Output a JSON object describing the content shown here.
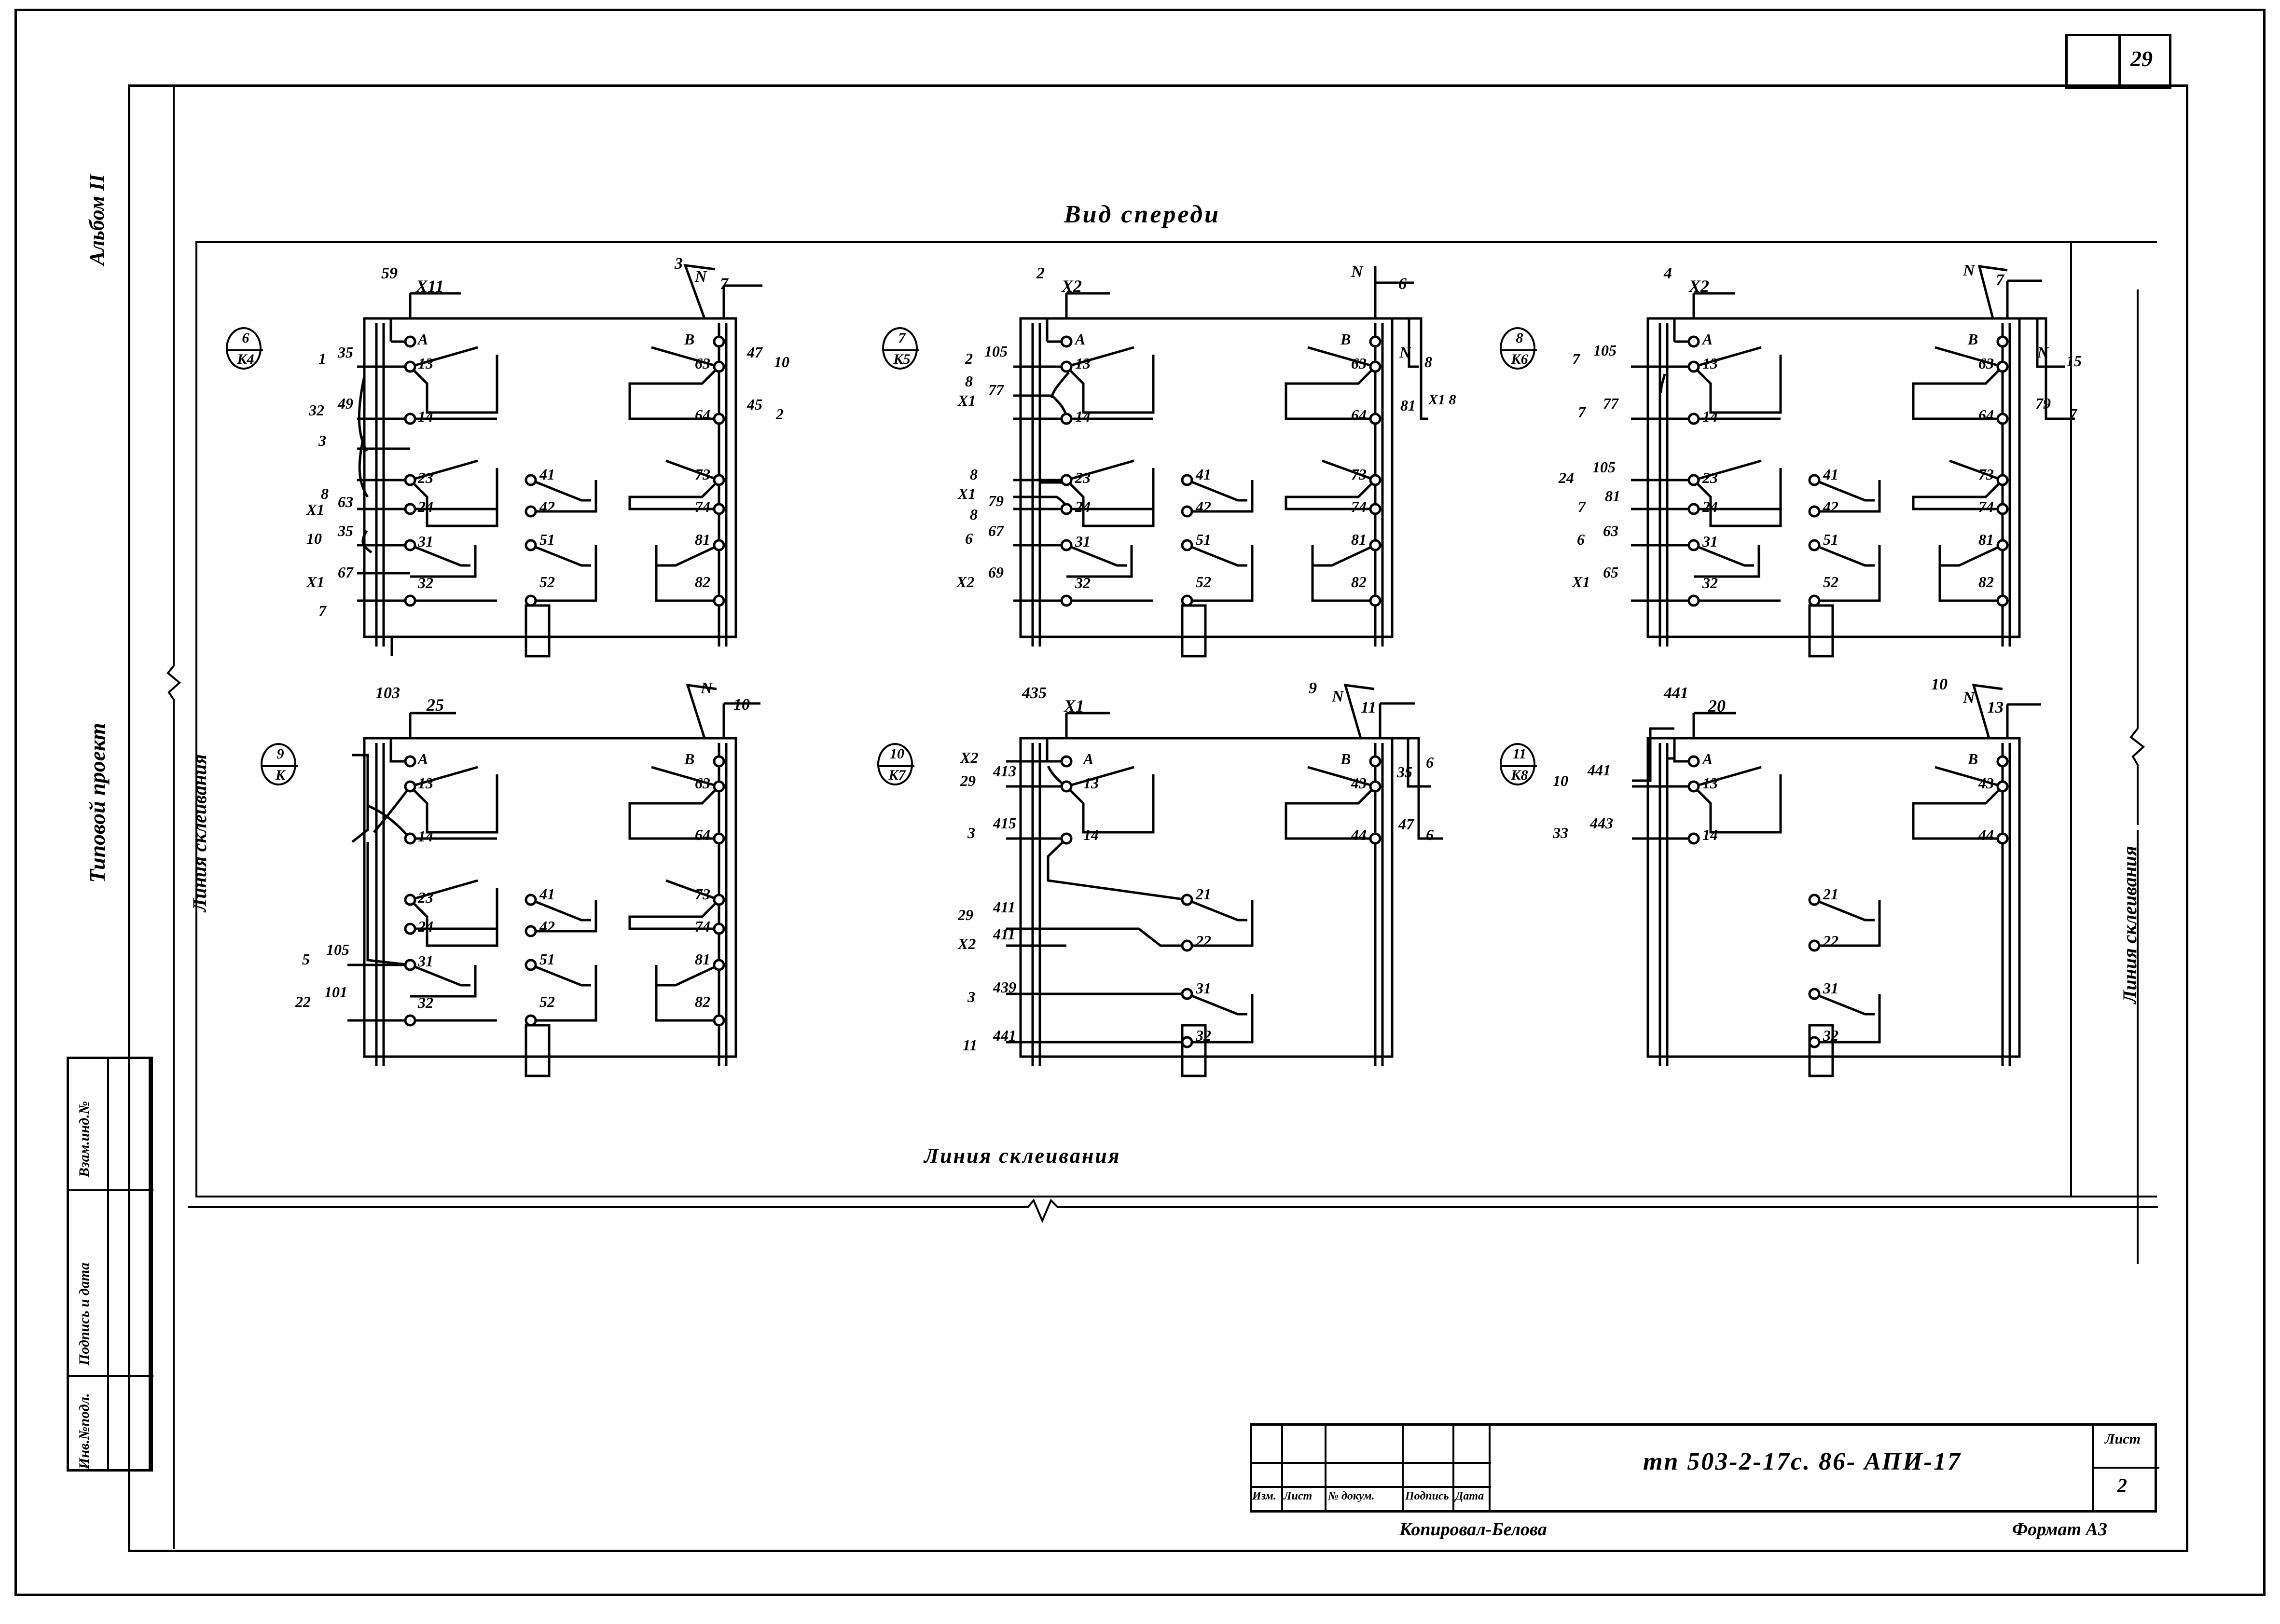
{
  "sheet": {
    "page_number": "29",
    "view_title": "Вид спереди",
    "glue_line_bottom": "Линия склеивания",
    "glue_line_left": "Линия склеивания",
    "glue_line_right": "Линия склеивания",
    "album": "Альбом II",
    "project": "Типовой проект",
    "stamp_rows": [
      "Взам.инд.№",
      "Подпись и дата",
      "Инв.№подл."
    ]
  },
  "title_block": {
    "columns": [
      "Изм.",
      "Лист",
      "№ докум.",
      "Подпись",
      "Дата"
    ],
    "drawing_code": "тп  503-2-17с. 86-  АПИ-17",
    "sheet_label": "Лист",
    "sheet_value": "2",
    "copied_by": "Копировал-Белова",
    "format": "Формат А3"
  },
  "blocks": [
    {
      "id": "b6",
      "marker_top": "6",
      "marker_bottom": "К4",
      "top_left": {
        "wire": "59",
        "term": "X11"
      },
      "top_right": {
        "wire": "3",
        "phase": "N",
        "term": "7"
      },
      "left_terminals": [
        {
          "pin": "A",
          "wire": "",
          "node": ""
        },
        {
          "pin": "13",
          "wire": "35",
          "node": "1"
        },
        {
          "pin": "14",
          "wire": "49",
          "node": "32"
        },
        {
          "pin": "",
          "wire": "",
          "node": "3"
        },
        {
          "pin": "23",
          "wire": "",
          "node": ""
        },
        {
          "pin": "",
          "wire": "",
          "node": "8"
        },
        {
          "pin": "24",
          "wire": "63",
          "node": "X1"
        },
        {
          "pin": "31",
          "wire": "35",
          "node": "10"
        },
        {
          "pin": "32",
          "wire": "67",
          "node": "X1"
        },
        {
          "pin": "",
          "wire": "",
          "node": "7"
        }
      ],
      "mid_terminals": [
        "41",
        "42",
        "51",
        "52"
      ],
      "right_terminals": [
        {
          "pin": "B",
          "wire": "",
          "node": ""
        },
        {
          "pin": "63",
          "wire": "47",
          "node": "10"
        },
        {
          "pin": "64",
          "wire": "45",
          "node": "2"
        },
        {
          "pin": "73",
          "wire": "",
          "node": ""
        },
        {
          "pin": "74",
          "wire": "",
          "node": ""
        },
        {
          "pin": "81",
          "wire": "",
          "node": ""
        },
        {
          "pin": "82",
          "wire": "",
          "node": ""
        }
      ]
    },
    {
      "id": "b7",
      "marker_top": "7",
      "marker_bottom": "К5",
      "top_left": {
        "wire": "2",
        "term": "X2"
      },
      "top_right": {
        "wire": "",
        "phase": "N",
        "term": "6"
      },
      "left_terminals": [
        {
          "pin": "A",
          "wire": "",
          "node": ""
        },
        {
          "pin": "13",
          "wire": "105",
          "node": "2"
        },
        {
          "pin": "",
          "wire": "77",
          "node": "8"
        },
        {
          "pin": "14",
          "wire": "",
          "node": "X1"
        },
        {
          "pin": "23",
          "wire": "",
          "node": "8"
        },
        {
          "pin": "",
          "wire": "79",
          "node": "X1"
        },
        {
          "pin": "24",
          "wire": "",
          "node": "8"
        },
        {
          "pin": "31",
          "wire": "67",
          "node": "6"
        },
        {
          "pin": "32",
          "wire": "69",
          "node": "X2"
        }
      ],
      "mid_terminals": [
        "41",
        "42",
        "51",
        "52"
      ],
      "right_terminals": [
        {
          "pin": "B",
          "wire": "",
          "node": ""
        },
        {
          "pin": "63",
          "wire": "N",
          "node": "8"
        },
        {
          "pin": "64",
          "wire": "81",
          "node": "X1 8"
        },
        {
          "pin": "73",
          "wire": "",
          "node": ""
        },
        {
          "pin": "74",
          "wire": "",
          "node": ""
        },
        {
          "pin": "81",
          "wire": "",
          "node": ""
        },
        {
          "pin": "82",
          "wire": "",
          "node": ""
        }
      ]
    },
    {
      "id": "b8",
      "marker_top": "8",
      "marker_bottom": "К6",
      "top_left": {
        "wire": "4",
        "term": "X2"
      },
      "top_right": {
        "wire": "",
        "phase": "N",
        "term": "7"
      },
      "left_terminals": [
        {
          "pin": "A",
          "wire": "",
          "node": ""
        },
        {
          "pin": "13",
          "wire": "105",
          "node": "7"
        },
        {
          "pin": "14",
          "wire": "77",
          "node": "7"
        },
        {
          "pin": "23",
          "wire": "105",
          "node": "24"
        },
        {
          "pin": "24",
          "wire": "81",
          "node": "7"
        },
        {
          "pin": "31",
          "wire": "63",
          "node": "6"
        },
        {
          "pin": "32",
          "wire": "65",
          "node": "X1"
        }
      ],
      "mid_terminals": [
        "41",
        "42",
        "51",
        "52"
      ],
      "right_terminals": [
        {
          "pin": "B",
          "wire": "",
          "node": ""
        },
        {
          "pin": "63",
          "wire": "N",
          "node": "15"
        },
        {
          "pin": "64",
          "wire": "79",
          "node": "7"
        },
        {
          "pin": "73",
          "wire": "",
          "node": ""
        },
        {
          "pin": "74",
          "wire": "",
          "node": ""
        },
        {
          "pin": "81",
          "wire": "",
          "node": ""
        },
        {
          "pin": "82",
          "wire": "",
          "node": ""
        }
      ]
    },
    {
      "id": "b9",
      "marker_top": "9",
      "marker_bottom": "К",
      "top_left": {
        "wire": "103",
        "term": "25"
      },
      "top_right": {
        "wire": "",
        "phase": "N",
        "term": "10"
      },
      "left_terminals": [
        {
          "pin": "A",
          "wire": "",
          "node": ""
        },
        {
          "pin": "13",
          "wire": "",
          "node": ""
        },
        {
          "pin": "14",
          "wire": "",
          "node": ""
        },
        {
          "pin": "23",
          "wire": "",
          "node": ""
        },
        {
          "pin": "24",
          "wire": "",
          "node": ""
        },
        {
          "pin": "31",
          "wire": "105",
          "node": "5"
        },
        {
          "pin": "32",
          "wire": "101",
          "node": "22"
        }
      ],
      "mid_terminals": [
        "41",
        "42",
        "51",
        "52"
      ],
      "right_terminals": [
        {
          "pin": "B",
          "wire": "",
          "node": ""
        },
        {
          "pin": "63",
          "wire": "",
          "node": ""
        },
        {
          "pin": "64",
          "wire": "",
          "node": ""
        },
        {
          "pin": "73",
          "wire": "",
          "node": ""
        },
        {
          "pin": "74",
          "wire": "",
          "node": ""
        },
        {
          "pin": "81",
          "wire": "",
          "node": ""
        },
        {
          "pin": "82",
          "wire": "",
          "node": ""
        }
      ]
    },
    {
      "id": "b10",
      "marker_top": "10",
      "marker_bottom": "К7",
      "top_left": {
        "wire": "435",
        "term": "X1"
      },
      "top_right": {
        "wire": "9",
        "phase": "N",
        "term": "11"
      },
      "left_terminals": [
        {
          "pin": "A",
          "wire": "",
          "node": "X2"
        },
        {
          "pin": "13",
          "wire": "413",
          "node": "29"
        },
        {
          "pin": "14",
          "wire": "415",
          "node": "3"
        },
        {
          "pin": "21",
          "wire": "411",
          "node": "29"
        },
        {
          "pin": "22",
          "wire": "411",
          "node": "X2"
        },
        {
          "pin": "31",
          "wire": "439",
          "node": "3"
        },
        {
          "pin": "32",
          "wire": "441",
          "node": "11"
        }
      ],
      "mid_terminals": [
        "21",
        "22",
        "31",
        "32"
      ],
      "right_terminals": [
        {
          "pin": "B",
          "wire": "",
          "node": ""
        },
        {
          "pin": "43",
          "wire": "35",
          "node": "6"
        },
        {
          "pin": "44",
          "wire": "47",
          "node": "6"
        }
      ]
    },
    {
      "id": "b11",
      "marker_top": "11",
      "marker_bottom": "К8",
      "top_left": {
        "wire": "441",
        "term": "20"
      },
      "top_right": {
        "wire": "10",
        "phase": "N",
        "term": "13"
      },
      "left_terminals": [
        {
          "pin": "A",
          "wire": "",
          "node": ""
        },
        {
          "pin": "13",
          "wire": "441",
          "node": "10"
        },
        {
          "pin": "14",
          "wire": "443",
          "node": "33"
        }
      ],
      "mid_terminals": [
        "21",
        "22",
        "31",
        "32"
      ],
      "right_terminals": [
        {
          "pin": "B",
          "wire": "",
          "node": ""
        },
        {
          "pin": "43",
          "wire": "",
          "node": ""
        },
        {
          "pin": "44",
          "wire": "",
          "node": ""
        }
      ]
    }
  ]
}
